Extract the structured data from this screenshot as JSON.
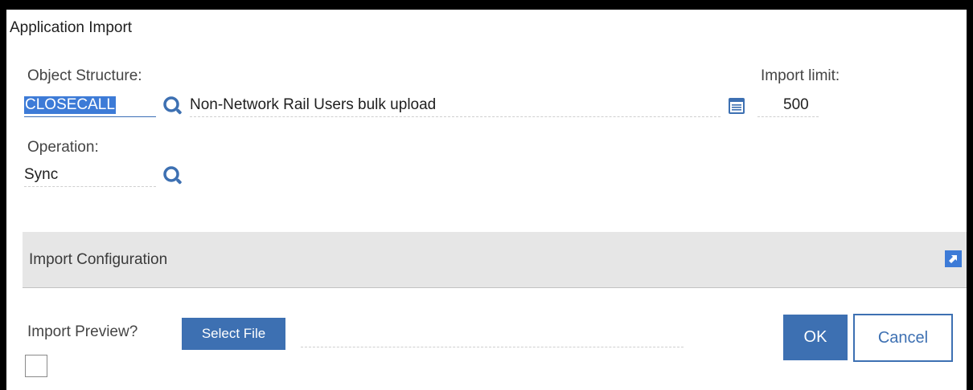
{
  "dialog": {
    "title": "Application Import"
  },
  "object_structure": {
    "label": "Object Structure:",
    "value": "CLOSECALL",
    "lookup_icon": "search-icon",
    "description": "Non-Network Rail Users bulk upload",
    "detail_icon": "detail-menu-icon"
  },
  "import_limit": {
    "label": "Import limit:",
    "value": "500"
  },
  "operation": {
    "label": "Operation:",
    "value": "Sync",
    "lookup_icon": "search-icon"
  },
  "import_configuration": {
    "title": "Import Configuration",
    "expand_icon": "expand-arrow-icon"
  },
  "import_preview": {
    "label": "Import Preview?",
    "checked": false
  },
  "select_file": {
    "label": "Select File",
    "file_name": ""
  },
  "actions": {
    "ok_label": "OK",
    "cancel_label": "Cancel"
  },
  "colors": {
    "primary": "#3d70b2",
    "selection": "#3d7bd7",
    "section_bg": "#e6e6e6"
  }
}
